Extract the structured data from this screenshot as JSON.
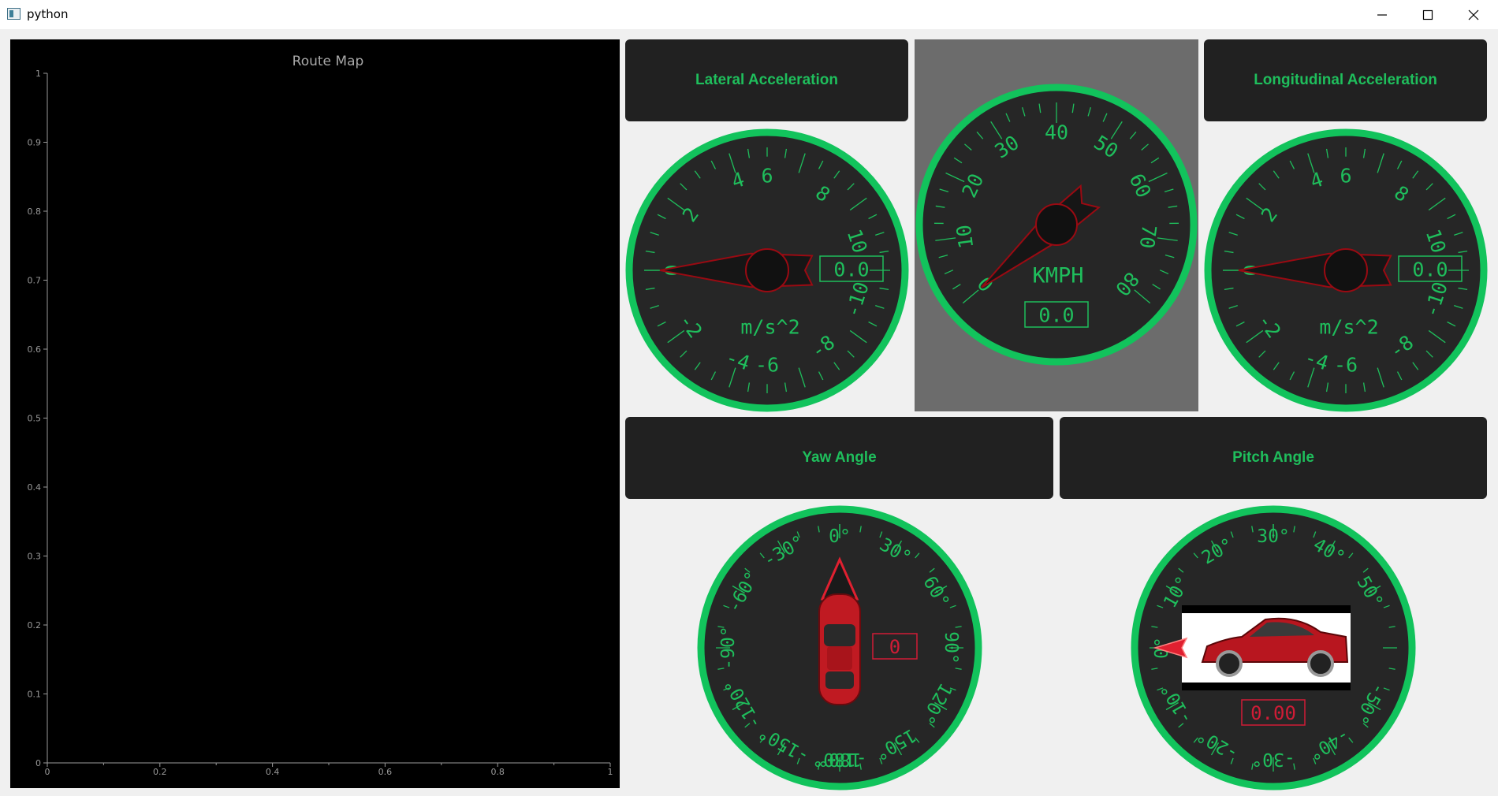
{
  "window": {
    "title": "python",
    "buttons": {
      "minimize": "minimize-icon",
      "maximize": "maximize-icon",
      "close": "close-icon"
    }
  },
  "route_map": {
    "title": "Route Map",
    "chart_data": {
      "type": "line",
      "title": "Route Map",
      "x": [],
      "y": [],
      "xlim": [
        0,
        1
      ],
      "ylim": [
        0,
        1
      ],
      "xticks": [
        "0",
        "0.2",
        "0.4",
        "0.6",
        "0.8",
        "1"
      ],
      "yticks": [
        "0",
        "0.1",
        "0.2",
        "0.3",
        "0.4",
        "0.5",
        "0.6",
        "0.7",
        "0.8",
        "0.9",
        "1"
      ],
      "grid": false
    }
  },
  "panels": {
    "lateral": "Lateral Acceleration",
    "longitudinal": "Longitudinal Acceleration",
    "yaw": "Yaw Angle",
    "pitch": "Pitch Angle"
  },
  "gauges": {
    "lateral": {
      "unit": "m/s^2",
      "value": "0.0",
      "needle": 0,
      "labels": [
        "-10",
        "-8",
        "-6",
        "-4",
        "-2",
        "0",
        "2",
        "4",
        "6",
        "8",
        "10"
      ]
    },
    "speed": {
      "unit": "KMPH",
      "value": "0.0",
      "needle": 0,
      "labels": [
        "0",
        "10",
        "20",
        "30",
        "40",
        "50",
        "60",
        "70",
        "80"
      ]
    },
    "longitudinal": {
      "unit": "m/s^2",
      "value": "0.0",
      "needle": 0,
      "labels": [
        "-10",
        "-8",
        "-6",
        "-4",
        "-2",
        "0",
        "2",
        "4",
        "6",
        "8",
        "10"
      ]
    },
    "yaw": {
      "value": "0",
      "needle": 0,
      "labels": [
        "-180",
        "-150",
        "-120",
        "-90",
        "-60",
        "-30",
        "0",
        "30",
        "60",
        "90",
        "120",
        "150",
        "180"
      ]
    },
    "pitch": {
      "value": "0.00",
      "needle": 0,
      "labels": [
        "-30",
        "-40",
        "-50",
        "0",
        "10",
        "20",
        "30",
        "40",
        "50",
        "-10",
        "-20"
      ]
    }
  },
  "colors": {
    "gauge_ring": "#12c35c",
    "gauge_face": "#262626",
    "gauge_text": "#1fbe5c",
    "needle": "#9a0a12",
    "red_text": "#d01c36"
  }
}
